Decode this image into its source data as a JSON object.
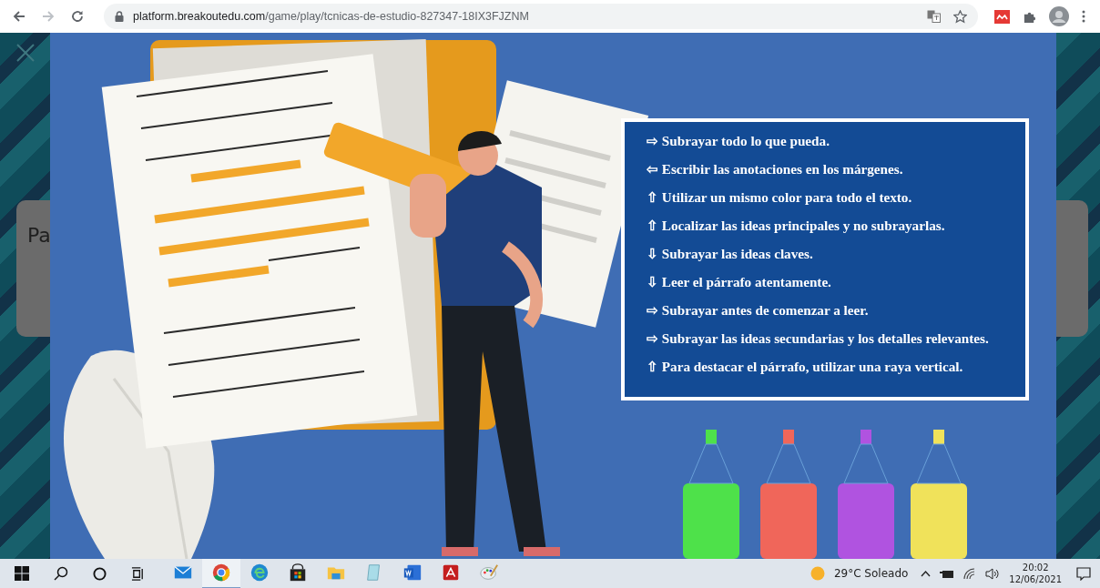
{
  "browser": {
    "url": {
      "host": "platform.breakoutedu.com",
      "path": "/game/play/tcnicas-de-estudio-827347-18IX3FJZNM"
    }
  },
  "game": {
    "card_text": "Pa",
    "tips": [
      "⇨ Subrayar todo lo que pueda.",
      "⇦ Escribir las anotaciones en los márgenes.",
      "⇧ Utilizar un mismo color para todo el texto.",
      "⇧ Localizar las ideas principales y no subrayarlas.",
      "⇩ Subrayar las ideas claves.",
      "⇩ Leer el párrafo atentamente.",
      "⇨ Subrayar antes de comenzar a leer.",
      "⇨ Subrayar las ideas secundarias y los detalles relevantes.",
      "⇧ Para destacar el párrafo, utilizar una raya vertical."
    ]
  },
  "taskbar": {
    "apps": [
      {
        "kind": "mail",
        "selected": false
      },
      {
        "kind": "chrome",
        "selected": true
      },
      {
        "kind": "edge",
        "selected": false
      },
      {
        "kind": "store",
        "selected": false
      },
      {
        "kind": "folder",
        "selected": false
      },
      {
        "kind": "notepad",
        "selected": false
      },
      {
        "kind": "word",
        "selected": false
      },
      {
        "kind": "acrobat",
        "selected": false
      },
      {
        "kind": "paint",
        "selected": false
      }
    ],
    "weather": {
      "temperature": "29°C",
      "condition": "Soleado"
    },
    "clock": {
      "time": "20:02",
      "date": "12/06/2021"
    }
  }
}
